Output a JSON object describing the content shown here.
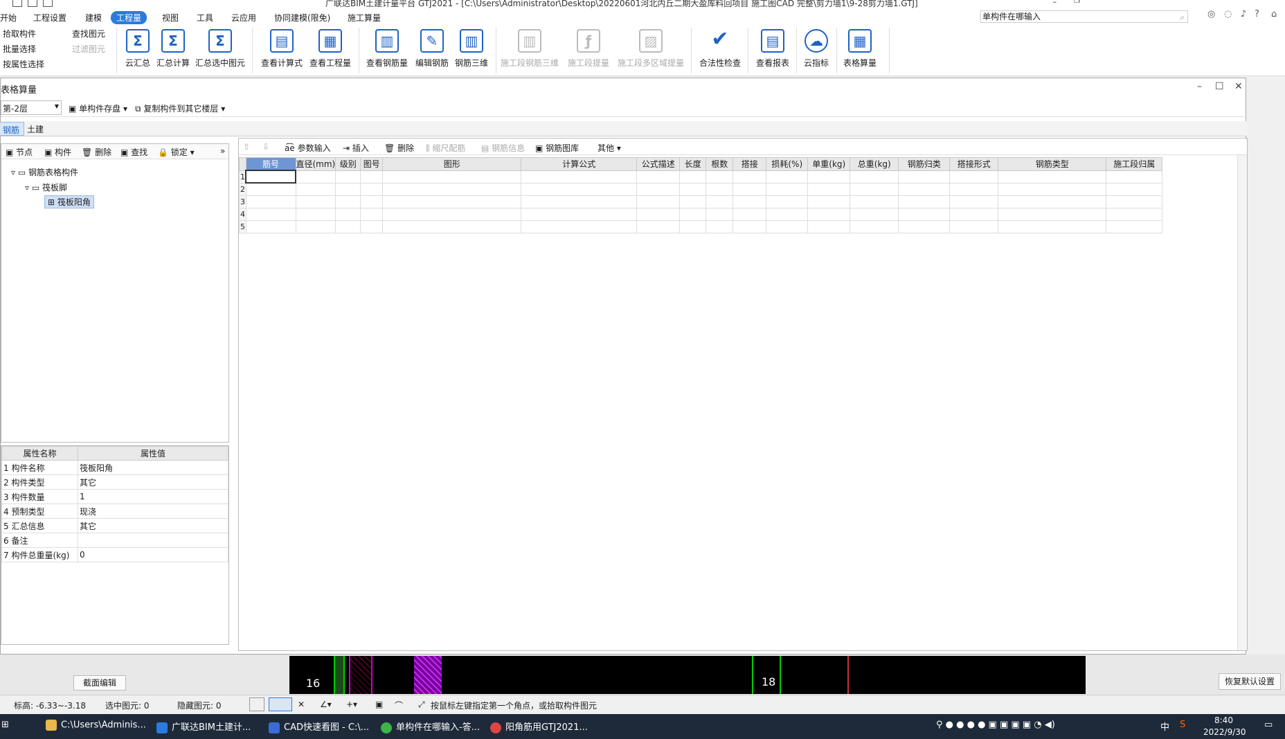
{
  "window": {
    "title": "广联达BIM土建计量平台 GTJ2021 - [C:\\Users\\Administrator\\Desktop\\20220601河北内丘二期大盈库料回项目 施工图CAD 完整\\剪力墙1\\9-28剪力墙1.GTJ]"
  },
  "menu": {
    "items": [
      "开始",
      "工程设置",
      "建模",
      "工程量",
      "视图",
      "工具",
      "云应用",
      "协同建模(限免)",
      "施工算量"
    ],
    "active_index": 3
  },
  "search": {
    "value": "单构件在哪输入"
  },
  "ribbon": {
    "left_small": [
      "拾取构件",
      "批量选择",
      "按属性选择",
      "查找图元",
      "过滤图元"
    ],
    "buttons": [
      {
        "label": "云汇总",
        "icon": "cloud-sum-icon",
        "enabled": true
      },
      {
        "label": "汇总计算",
        "icon": "sigma-icon",
        "enabled": true
      },
      {
        "label": "汇总选中图元",
        "icon": "sigma-select-icon",
        "enabled": true
      },
      {
        "label": "查看计算式",
        "icon": "formula-view-icon",
        "enabled": true
      },
      {
        "label": "查看工程量",
        "icon": "quantity-view-icon",
        "enabled": true
      },
      {
        "label": "查看钢筋量",
        "icon": "rebar-view-icon",
        "enabled": true
      },
      {
        "label": "编辑钢筋",
        "icon": "rebar-edit-icon",
        "enabled": true
      },
      {
        "label": "钢筋三维",
        "icon": "rebar-3d-icon",
        "enabled": true
      },
      {
        "label": "施工段钢筋三维",
        "icon": "segment-3d-icon",
        "enabled": false
      },
      {
        "label": "施工段提量",
        "icon": "segment-quantity-icon",
        "enabled": false
      },
      {
        "label": "施工段多区域提量",
        "icon": "segment-multi-icon",
        "enabled": false
      },
      {
        "label": "合法性检查",
        "icon": "check-icon",
        "enabled": true
      },
      {
        "label": "查看报表",
        "icon": "report-icon",
        "enabled": true
      },
      {
        "label": "云指标",
        "icon": "cloud-index-icon",
        "enabled": true
      },
      {
        "label": "表格算量",
        "icon": "table-calc-icon",
        "enabled": true
      }
    ]
  },
  "dialog": {
    "title": "表格算量",
    "floor": "第-2层",
    "floor_actions": [
      "单构件存盘",
      "复制构件到其它楼层"
    ],
    "tabs": [
      "钢筋",
      "土建"
    ],
    "tree_toolbar": [
      "节点",
      "构件",
      "删除",
      "查找",
      "锁定"
    ],
    "tree": {
      "root": "钢筋表格构件",
      "child": "筏板脚",
      "leaf": "筏板阳角"
    },
    "props": {
      "headers": [
        "属性名称",
        "属性值"
      ],
      "rows": [
        {
          "n": "1",
          "name": "构件名称",
          "value": "筏板阳角"
        },
        {
          "n": "2",
          "name": "构件类型",
          "value": "其它"
        },
        {
          "n": "3",
          "name": "构件数量",
          "value": "1"
        },
        {
          "n": "4",
          "name": "预制类型",
          "value": "现浇"
        },
        {
          "n": "5",
          "name": "汇总信息",
          "value": "其它"
        },
        {
          "n": "6",
          "name": "备注",
          "value": ""
        },
        {
          "n": "7",
          "name": "构件总重量(kg)",
          "value": "0"
        }
      ]
    },
    "grid_toolbar": [
      "参数输入",
      "插入",
      "删除",
      "缩尺配筋",
      "钢筋信息",
      "钢筋图库",
      "其他"
    ],
    "grid": {
      "headers": [
        "筋号",
        "直径(mm)",
        "级别",
        "图号",
        "图形",
        "计算公式",
        "公式描述",
        "长度",
        "根数",
        "搭接",
        "损耗(%)",
        "单重(kg)",
        "总重(kg)",
        "钢筋归类",
        "搭接形式",
        "钢筋类型",
        "施工段归属"
      ],
      "rows": [
        "1",
        "2",
        "3",
        "4",
        "5"
      ]
    }
  },
  "bottom": {
    "section_edit": "截面编辑",
    "restore": "恢复默认设置",
    "cad_labels": [
      "16",
      "18"
    ]
  },
  "status": {
    "elevation": "标高:  -6.33~-3.18",
    "selected": "选中图元:  0",
    "hidden": "隐藏图元:  0",
    "hint": "按鼠标左键指定第一个角点，或拾取构件图元"
  },
  "taskbar": {
    "items": [
      "C:\\Users\\Adminis...",
      "广联达BIM土建计...",
      "CAD快速看图 - C:\\...",
      "单构件在哪输入-答...",
      "阳角筋用GTJ2021..."
    ],
    "ime": "中",
    "time": "8:40",
    "date": "2022/9/30"
  },
  "colors": {
    "accent": "#2b7bdc",
    "icon": "#1f62c4",
    "grid_header_active": "#6f96d4",
    "taskbar": "#1e2a3a"
  }
}
